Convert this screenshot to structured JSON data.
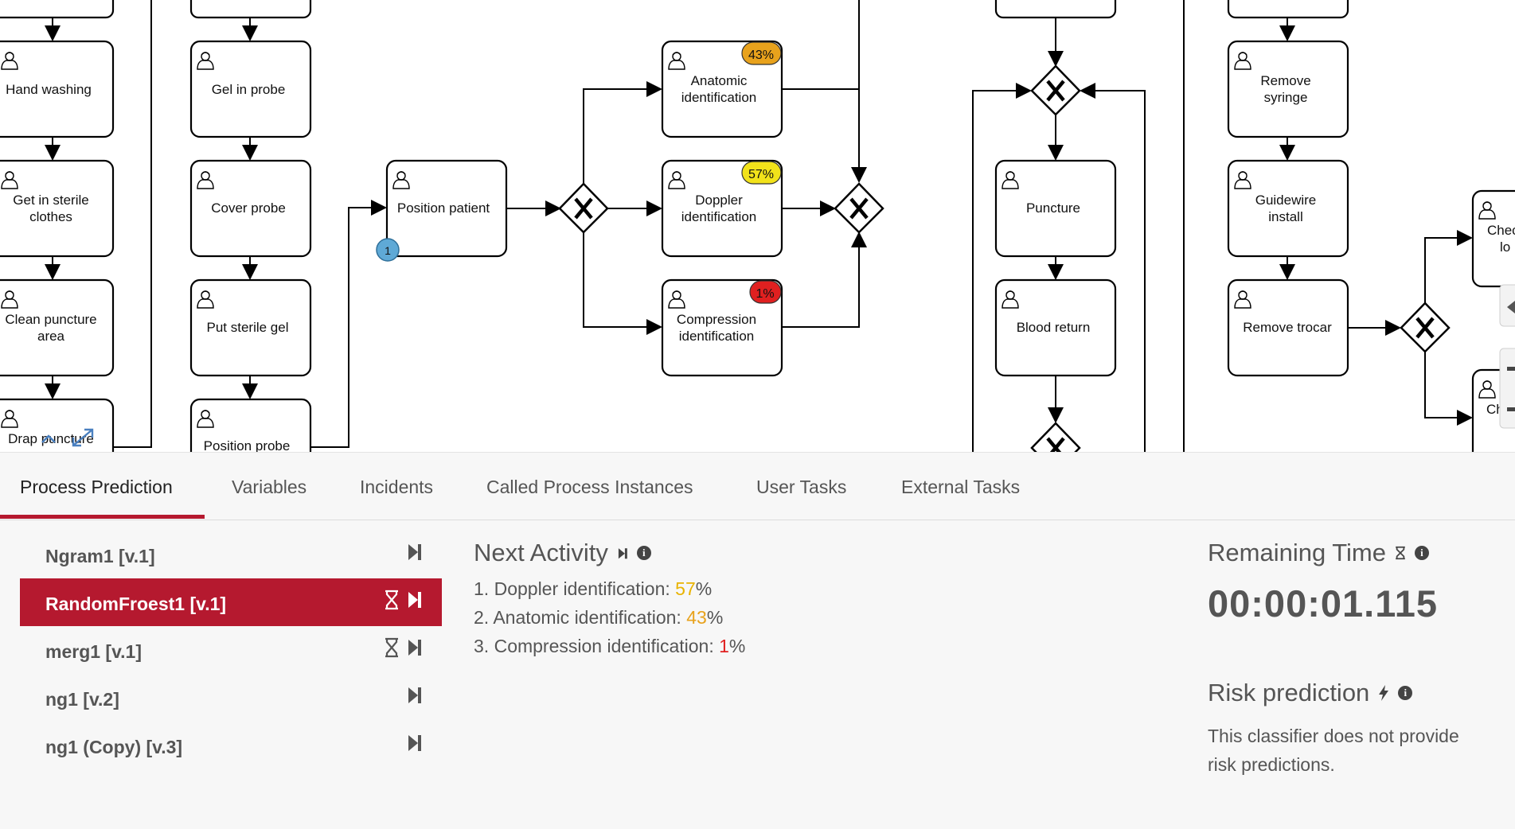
{
  "diagram": {
    "tasks": {
      "hand_washing": [
        "Hand washing"
      ],
      "get_in_sterile": [
        "Get in sterile",
        "clothes"
      ],
      "clean_puncture": [
        "Clean puncture",
        "area"
      ],
      "drap_puncture": [
        "Drap puncture"
      ],
      "gel_in_probe": [
        "Gel in probe"
      ],
      "cover_probe": [
        "Cover probe"
      ],
      "put_sterile_gel": [
        "Put sterile gel"
      ],
      "position_probe": [
        "Position probe"
      ],
      "position_patient": [
        "Position patient"
      ],
      "anatomic": [
        "Anatomic",
        "identification"
      ],
      "doppler": [
        "Doppler",
        "identification"
      ],
      "compression": [
        "Compression",
        "identification"
      ],
      "puncture": [
        "Puncture"
      ],
      "blood_return": [
        "Blood return"
      ],
      "remove_syringe": [
        "Remove",
        "syringe"
      ],
      "guidewire": [
        "Guidewire",
        "install"
      ],
      "remove_trocar": [
        "Remove trocar"
      ],
      "check_partial_1": [
        "Chec",
        "lo"
      ],
      "check_partial_2": [
        "Ch"
      ]
    },
    "badges": {
      "anatomic": "43%",
      "doppler": "57%",
      "compression": "1%",
      "position_patient_count": "1"
    },
    "colors": {
      "badge_high": "#f2e21a",
      "badge_mid": "#e8a21c",
      "badge_low": "#e02020",
      "badge_count": "#5fa9d6"
    }
  },
  "tabs": [
    {
      "label": "Process Prediction",
      "active": true
    },
    {
      "label": "Variables"
    },
    {
      "label": "Incidents"
    },
    {
      "label": "Called Process Instances"
    },
    {
      "label": "User Tasks"
    },
    {
      "label": "External Tasks"
    }
  ],
  "models": [
    {
      "label": "Ngram1 [v.1]",
      "icons": [
        "step-forward-icon"
      ]
    },
    {
      "label": "RandomFroest1 [v.1]",
      "icons": [
        "hourglass-icon",
        "step-forward-icon"
      ],
      "selected": true
    },
    {
      "label": "merg1 [v.1]",
      "icons": [
        "hourglass-icon",
        "step-forward-icon"
      ]
    },
    {
      "label": "ng1 [v.2]",
      "icons": [
        "step-forward-icon"
      ]
    },
    {
      "label": "ng1 (Copy) [v.3]",
      "icons": [
        "step-forward-icon"
      ]
    }
  ],
  "next_activity": {
    "title": "Next Activity",
    "predictions": [
      {
        "rank": "1.",
        "name": "Doppler identification:",
        "value": "57",
        "unit": "%"
      },
      {
        "rank": "2.",
        "name": "Anatomic identification:",
        "value": "43",
        "unit": "%"
      },
      {
        "rank": "3.",
        "name": "Compression identification:",
        "value": "1",
        "unit": "%"
      }
    ]
  },
  "remaining_time": {
    "title": "Remaining Time",
    "value": "00:00:01.115"
  },
  "risk": {
    "title": "Risk prediction",
    "text_line1": "This classifier does not provide",
    "text_line2": "risk predictions."
  },
  "accent_color": "#b5192f"
}
